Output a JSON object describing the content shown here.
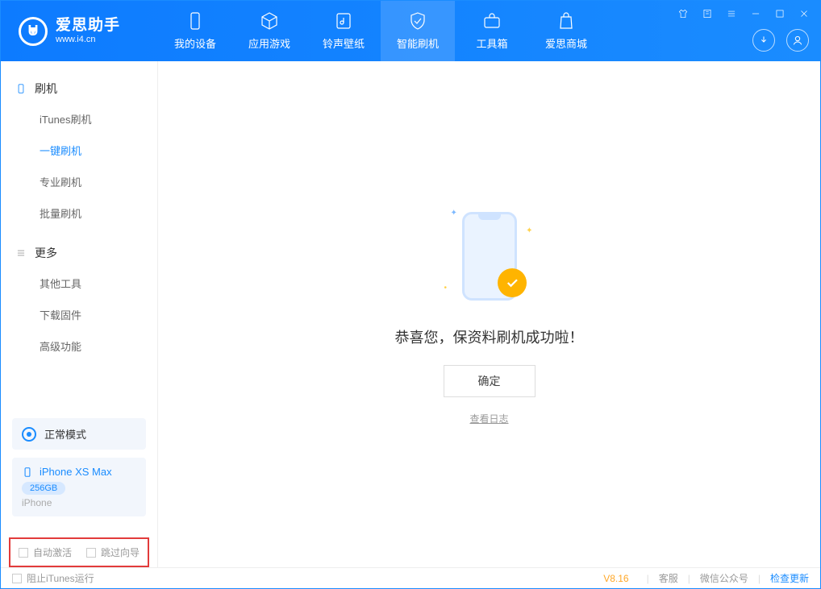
{
  "app": {
    "name_cn": "爱思助手",
    "name_en": "www.i4.cn"
  },
  "nav": {
    "device": "我的设备",
    "apps": "应用游戏",
    "ringtone": "铃声壁纸",
    "flash": "智能刷机",
    "toolbox": "工具箱",
    "store": "爱思商城"
  },
  "sidebar": {
    "group_flash": "刷机",
    "items_flash": {
      "itunes": "iTunes刷机",
      "oneclick": "一键刷机",
      "pro": "专业刷机",
      "batch": "批量刷机"
    },
    "group_more": "更多",
    "items_more": {
      "other": "其他工具",
      "firmware": "下载固件",
      "advanced": "高级功能"
    },
    "mode": "正常模式",
    "device": {
      "name": "iPhone XS Max",
      "storage": "256GB",
      "type": "iPhone"
    },
    "cb_activate": "自动激活",
    "cb_skip": "跳过向导"
  },
  "main": {
    "success": "恭喜您，保资料刷机成功啦！",
    "ok": "确定",
    "view_log": "查看日志"
  },
  "footer": {
    "block_itunes": "阻止iTunes运行",
    "version": "V8.16",
    "support": "客服",
    "wechat": "微信公众号",
    "update": "检查更新"
  }
}
